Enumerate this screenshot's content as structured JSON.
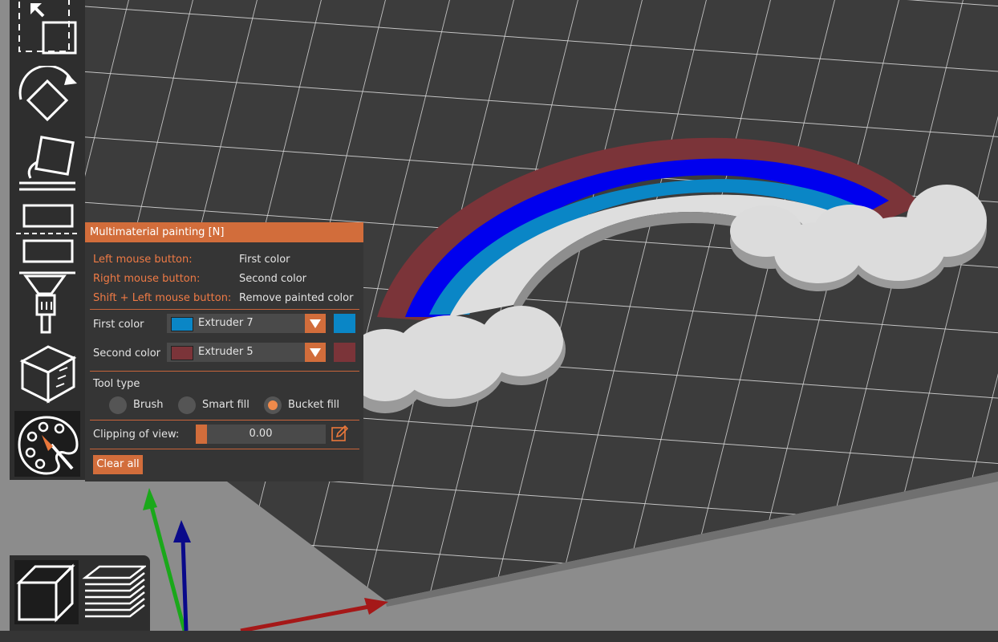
{
  "panel": {
    "title": "Multimaterial painting [N]",
    "hints": [
      {
        "key": "Left mouse button:",
        "value": "First color"
      },
      {
        "key": "Right mouse button:",
        "value": "Second color"
      },
      {
        "key": "Shift + Left mouse button:",
        "value": "Remove painted color"
      }
    ],
    "first_color": {
      "label": "First color",
      "extruder": "Extruder 7",
      "color": "#0a86c6"
    },
    "second_color": {
      "label": "Second color",
      "extruder": "Extruder 5",
      "color": "#7b3439"
    },
    "tool_type": {
      "label": "Tool type",
      "options": [
        "Brush",
        "Smart fill",
        "Bucket fill"
      ],
      "selected": "Bucket fill"
    },
    "clipping": {
      "label": "Clipping of view:",
      "value": "0.00"
    },
    "clear_label": "Clear all"
  },
  "toolbar": {
    "tools": [
      "move-tool",
      "rotate-tool",
      "place-on-face-tool",
      "cut-tool",
      "support-paint-tool",
      "seam-paint-tool",
      "multimaterial-paint-tool"
    ],
    "active": "multimaterial-paint-tool"
  },
  "view_toggle": {
    "options": [
      "3d-view",
      "layer-preview"
    ],
    "active": "3d-view"
  },
  "colors": {
    "accent": "#d26d3b",
    "panel_bg": "#353535",
    "rainbow_outer": "#7b3439",
    "rainbow_blue": "#0000ee",
    "rainbow_teal": "#0a86c6",
    "cloud": "#dcdcdc"
  }
}
